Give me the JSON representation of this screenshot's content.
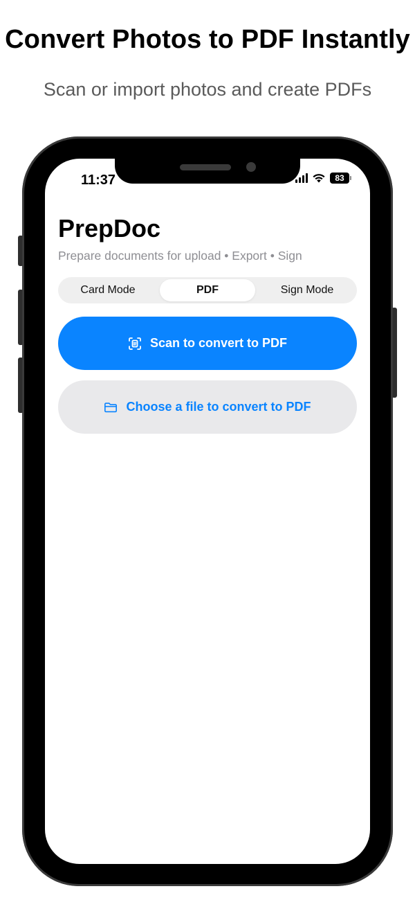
{
  "promo": {
    "headline": "Convert Photos to PDF Instantly",
    "subline": "Scan or import photos and create PDFs"
  },
  "status_bar": {
    "time": "11:37",
    "battery": "83",
    "icons": [
      "signal-icon",
      "wifi-icon",
      "battery-icon"
    ]
  },
  "app": {
    "title": "PrepDoc",
    "subtitle": "Prepare documents for upload • Export • Sign"
  },
  "segmented_control": {
    "items": [
      {
        "label": "Card Mode",
        "active": false
      },
      {
        "label": "PDF",
        "active": true
      },
      {
        "label": "Sign Mode",
        "active": false
      }
    ]
  },
  "actions": {
    "scan_label": "Scan to convert to PDF",
    "scan_icon": "document-scanner-icon",
    "file_label": "Choose a file to convert to PDF",
    "file_icon": "folder-icon"
  },
  "colors": {
    "accent": "#0a84ff",
    "secondary_button": "#e9e9eb",
    "muted_text": "#8e8e93"
  }
}
